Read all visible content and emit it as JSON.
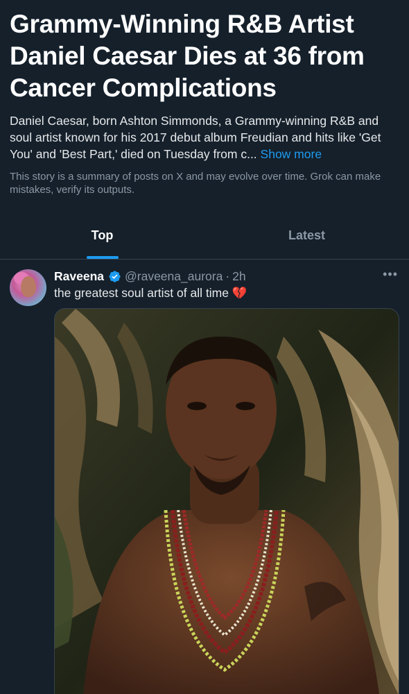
{
  "story": {
    "headline": "Grammy-Winning R&B Artist Daniel Caesar Dies at 36 from Cancer Complications",
    "summary": "Daniel Caesar, born Ashton Simmonds, a Grammy-winning R&B and soul artist known for his 2017 debut album Freudian and hits like 'Get You' and 'Best Part,' died on Tuesday from c...",
    "show_more_label": "Show more",
    "disclaimer": "This story is a summary of posts on X and may evolve over time. Grok can make mistakes, verify its outputs."
  },
  "tabs": [
    {
      "label": "Top",
      "active": true
    },
    {
      "label": "Latest",
      "active": false
    }
  ],
  "post": {
    "author": "Raveena",
    "handle": "@raveena_aurora",
    "separator": "·",
    "time": "2h",
    "text": "the greatest soul artist of all time",
    "emoji": "💔",
    "verified": true,
    "more_icon": "more-horizontal-icon",
    "avatar_icon": "avatar",
    "media_icon": "photo"
  },
  "colors": {
    "background": "#15202b",
    "accent": "#1d9bf0",
    "muted": "#8b98a5",
    "border": "#38444d"
  }
}
